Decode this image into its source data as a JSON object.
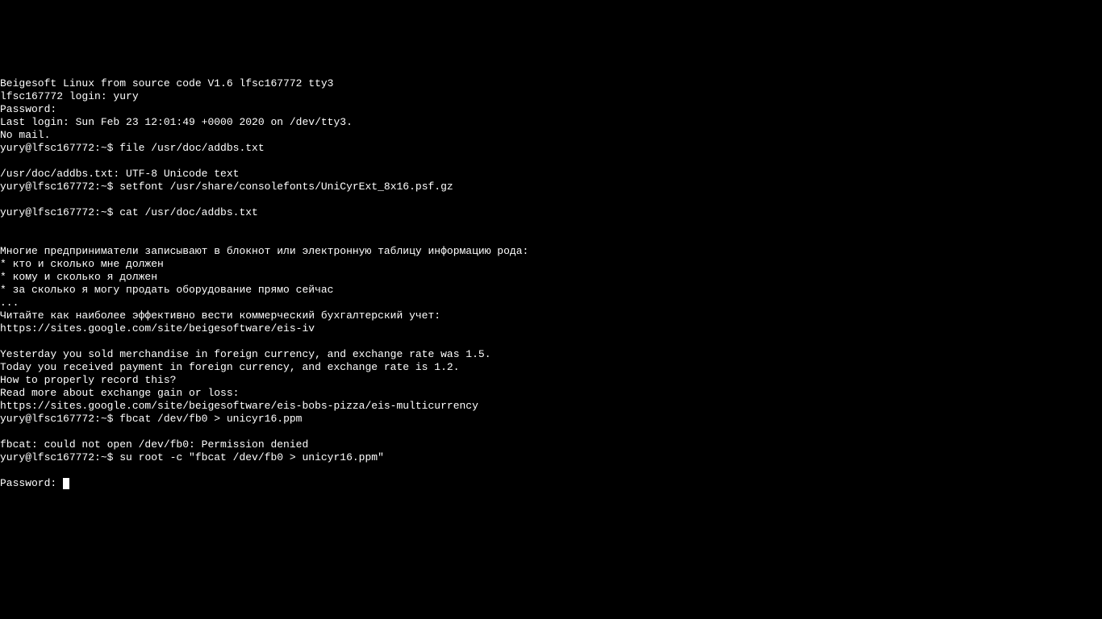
{
  "terminal": {
    "banner": "Beigesoft Linux from source code V1.6 lfsc167772 tty3",
    "login_prompt": "lfsc167772 login: yury",
    "password_prompt": "Password:",
    "last_login": "Last login: Sun Feb 23 12:01:49 +0000 2020 on /dev/tty3.",
    "no_mail": "No mail.",
    "prompt1": "yury@lfsc167772:~$ ",
    "cmd1": "file /usr/doc/addbs.txt",
    "out1": "/usr/doc/addbs.txt: UTF-8 Unicode text",
    "prompt2": "yury@lfsc167772:~$ ",
    "cmd2": "setfont /usr/share/consolefonts/UniCyrExt_8x16.psf.gz",
    "prompt3": "yury@lfsc167772:~$ ",
    "cmd3": "cat /usr/doc/addbs.txt",
    "blank": "",
    "ru1": "Многие предприниматели записывают в блокнот или электронную таблицу информацию рода:",
    "ru2": "* кто и сколько мне должен",
    "ru3": "* кому и сколько я должен",
    "ru4": "* за сколько я могу продать оборудование прямо сейчас",
    "ru5": "...",
    "ru6": "Читайте как наиболее эффективно вести коммерческий бухгалтерский учет:",
    "url1": "https://sites.google.com/site/beigesoftware/eis-iv",
    "en1": "Yesterday you sold merchandise in foreign currency, and exchange rate was 1.5.",
    "en2": "Today you received payment in foreign currency, and exchange rate is 1.2.",
    "en3": "How to properly record this?",
    "en4": "Read more about exchange gain or loss:",
    "url2": "https://sites.google.com/site/beigesoftware/eis-bobs-pizza/eis-multicurrency",
    "prompt4": "yury@lfsc167772:~$ ",
    "cmd4": "fbcat /dev/fb0 > unicyr16.ppm",
    "err1": "fbcat: could not open /dev/fb0: Permission denied",
    "prompt5": "yury@lfsc167772:~$ ",
    "cmd5": "su root -c \"fbcat /dev/fb0 > unicyr16.ppm\"",
    "password_prompt2": "Password: "
  }
}
